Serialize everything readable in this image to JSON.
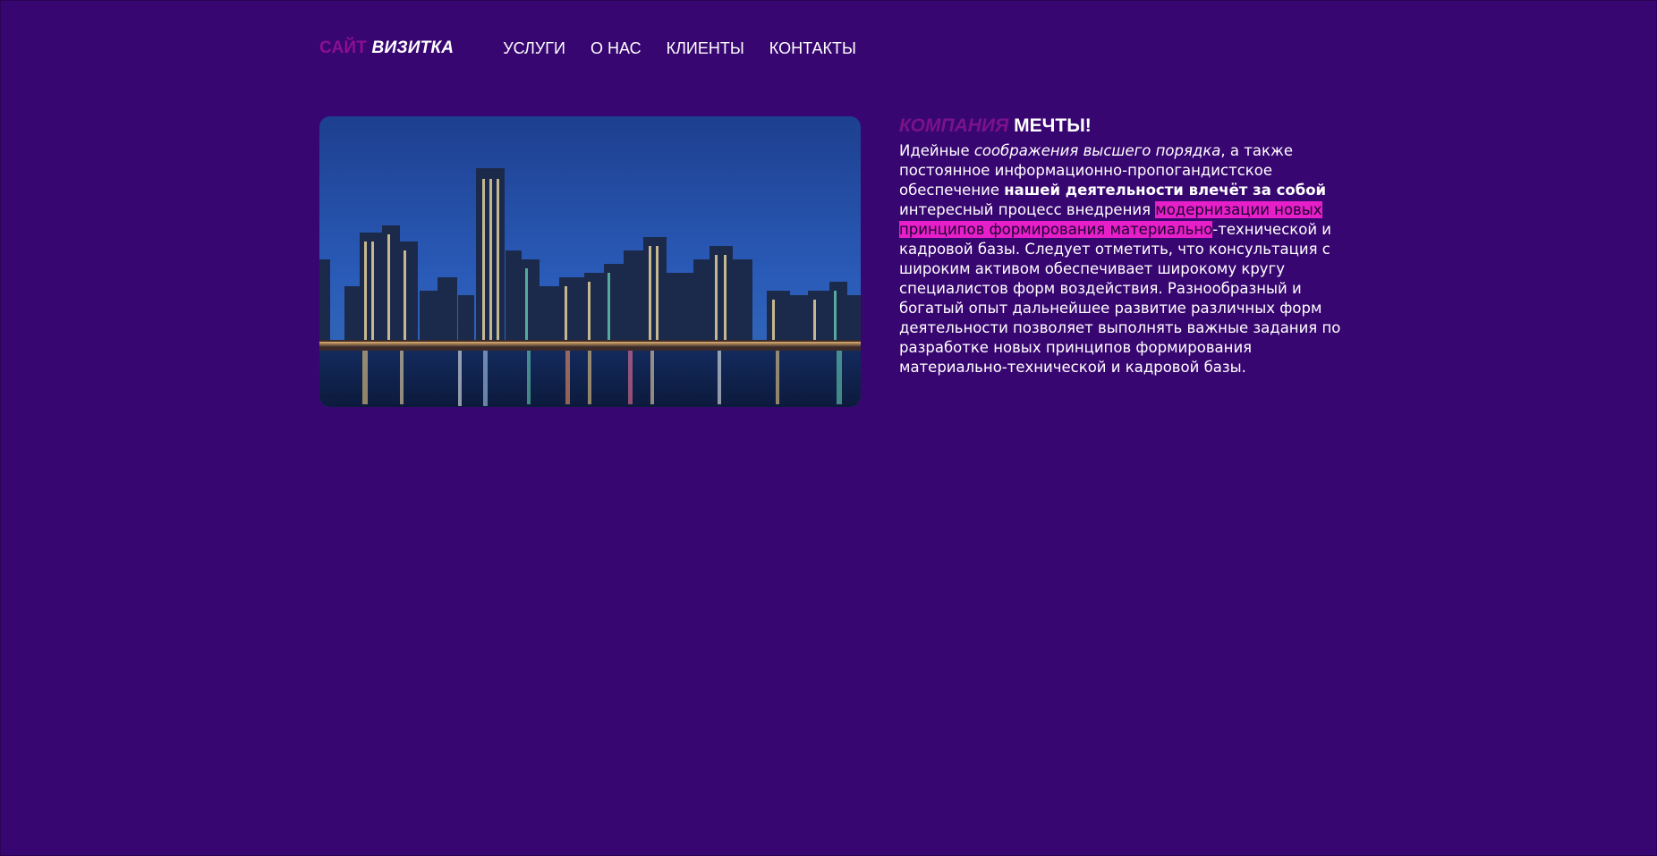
{
  "header": {
    "logo_part1": "САЙТ",
    "logo_part2": "ВИЗИТКА",
    "nav": [
      {
        "label": "УСЛУГИ"
      },
      {
        "label": "О НАС"
      },
      {
        "label": "КЛИЕНТЫ"
      },
      {
        "label": "КОНТАКТЫ"
      }
    ]
  },
  "main": {
    "title_part1": "КОМПАНИЯ",
    "title_part2": "МЕЧТЫ!",
    "text": {
      "p1": "Идейные ",
      "p2_italic": "соображения высшего порядка",
      "p3": ", а также постоянное информационно-пропогандистское обеспечение ",
      "p4_bold": "нашей деятельности влечёт за собой",
      "p5": " интересный процесс внедрения ",
      "p6_highlight": "модернизации новых принципов формирования материально",
      "p7": "-технической и кадровой базы. Следует отметить, что консультация с широким активом обеспечивает широкому кругу специалистов форм воздействия. Разнообразный и богатый опыт дальнейшее развитие различных форм деятельности позволяет выполнять важные задания по разработке новых принципов формирования материально-технической и кадровой базы."
    }
  },
  "colors": {
    "background": "#380671",
    "logo_accent": "#8c0f8f",
    "highlight": "#e61fc8"
  },
  "hero_image": {
    "subject": "city-skyline-at-night"
  }
}
